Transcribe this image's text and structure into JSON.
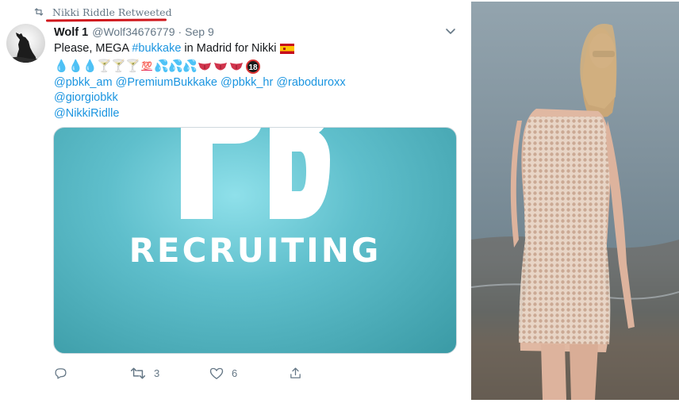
{
  "retweet_bar": {
    "label": "Nikki Riddle Retweeted",
    "icon": "retweet-icon"
  },
  "tweet": {
    "author_name": "Wolf 1",
    "author_handle": "@Wolf34676779",
    "separator": "·",
    "date": "Sep 9",
    "text_prefix": "Please, MEGA ",
    "hashtag": "#bukkake",
    "text_suffix": " in Madrid for Nikki",
    "flag": "spain-flag",
    "emoji_line": [
      "💧",
      "💧",
      "💧",
      "🍸",
      "🍸",
      "🍸",
      "💯",
      "💦",
      "💦",
      "💦",
      "👅",
      "👅",
      "👅",
      "🔞"
    ],
    "mentions_line1": [
      "@pbkk_am",
      "@PremiumBukkake",
      "@pbkk_hr",
      "@raboduroxx"
    ],
    "mentions_line2": "@giorgiobkk",
    "mentions_line3": "@NikkiRidlle",
    "card": {
      "logo_letters": "PB",
      "title": "RECRUITING",
      "bg_color": "#5fbfcc"
    },
    "actions": {
      "reply_count": "",
      "retweet_count": "3",
      "like_count": "6"
    }
  },
  "colors": {
    "link": "#1b95e0",
    "muted": "#657786",
    "underline": "#d0181d"
  }
}
